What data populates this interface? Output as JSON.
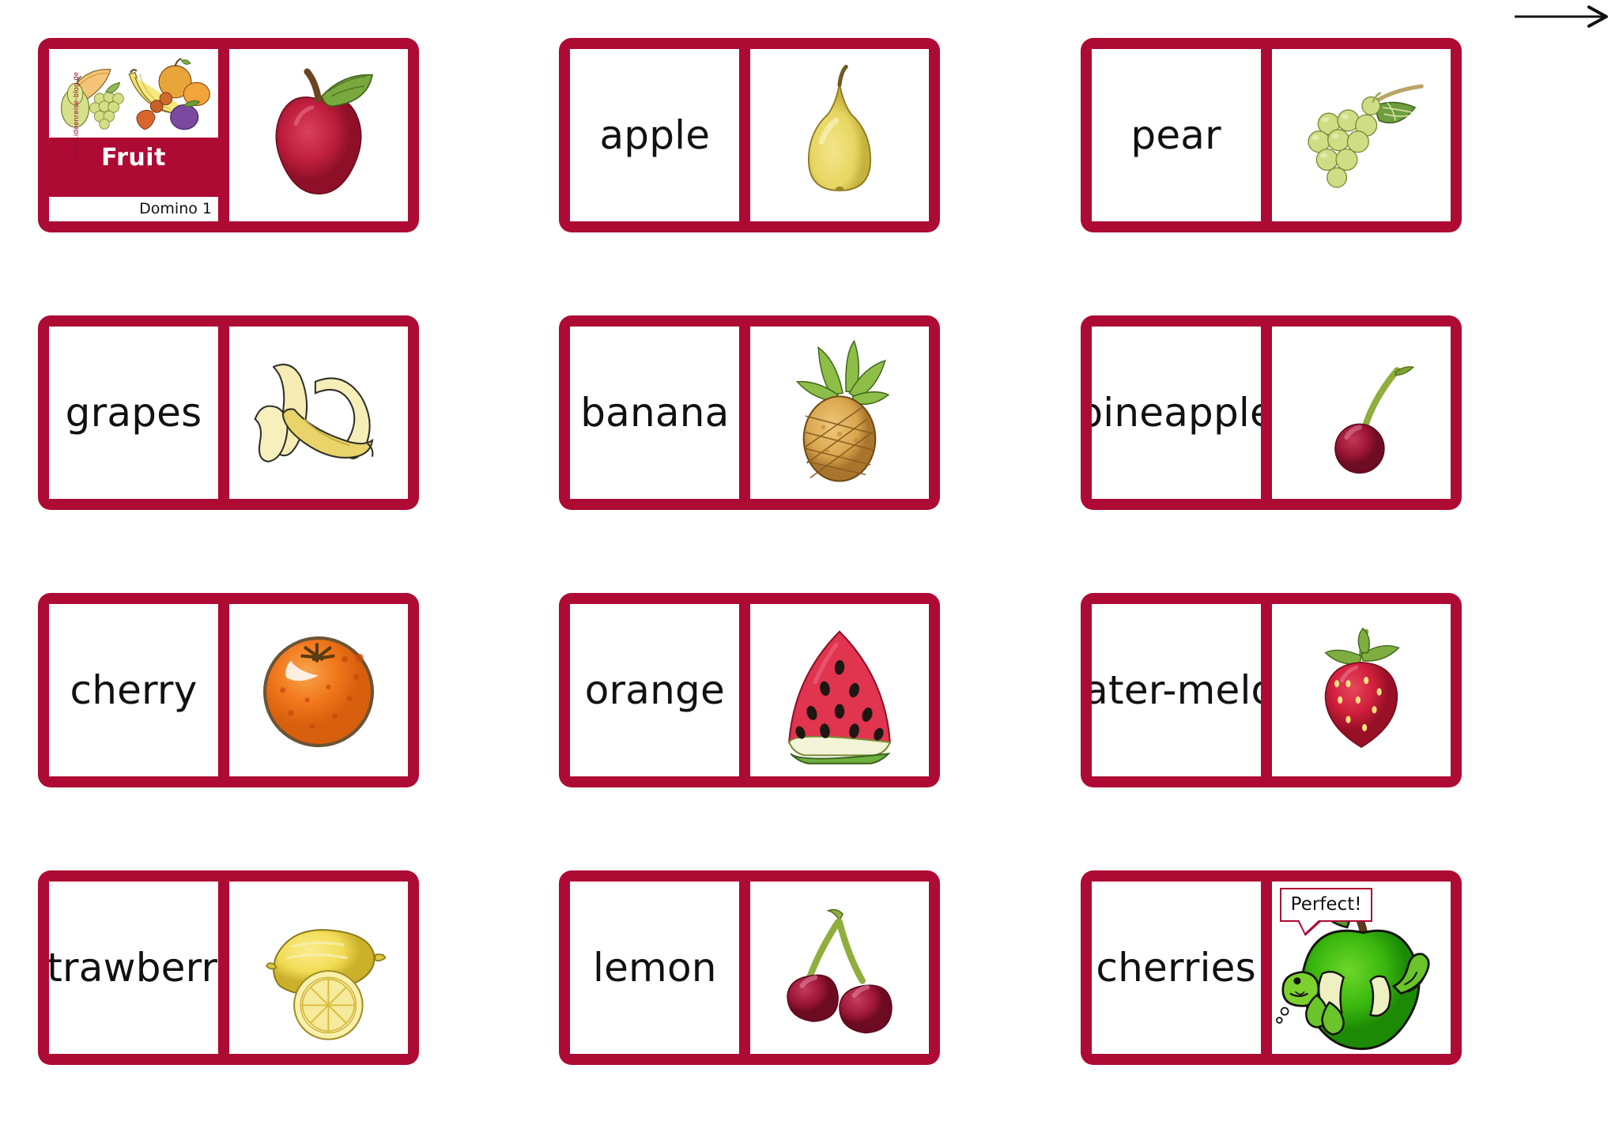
{
  "page": {
    "title": "Fruit",
    "subtitle": "Domino 1",
    "watermark": "© www.ideenreise-blog.de",
    "accent_color": "#ad0a34",
    "background_color": "#ffffff",
    "arrow_label": "next-page-arrow"
  },
  "dominoes": [
    {
      "id": "domino-1",
      "left": {
        "kind": "title",
        "title": "Fruit",
        "subtitle": "Domino 1",
        "picture": "assorted-fruit-basket"
      },
      "right": {
        "kind": "picture",
        "picture": "red-apple",
        "alt": "red apple with green leaf"
      }
    },
    {
      "id": "domino-2",
      "left": {
        "kind": "word",
        "word": "apple"
      },
      "right": {
        "kind": "picture",
        "picture": "pear",
        "alt": "yellow pear"
      }
    },
    {
      "id": "domino-3",
      "left": {
        "kind": "word",
        "word": "pear"
      },
      "right": {
        "kind": "picture",
        "picture": "grapes",
        "alt": "bunch of green grapes with leaf"
      }
    },
    {
      "id": "domino-4",
      "left": {
        "kind": "word",
        "word": "grapes"
      },
      "right": {
        "kind": "picture",
        "picture": "banana",
        "alt": "peeled banana"
      }
    },
    {
      "id": "domino-5",
      "left": {
        "kind": "word",
        "word": "banana"
      },
      "right": {
        "kind": "picture",
        "picture": "pineapple",
        "alt": "pineapple with green crown"
      }
    },
    {
      "id": "domino-6",
      "left": {
        "kind": "word",
        "word": "pineapple"
      },
      "right": {
        "kind": "picture",
        "picture": "cherry",
        "alt": "single red cherry with stem"
      }
    },
    {
      "id": "domino-7",
      "left": {
        "kind": "word",
        "word": "cherry"
      },
      "right": {
        "kind": "picture",
        "picture": "orange",
        "alt": "orange fruit"
      }
    },
    {
      "id": "domino-8",
      "left": {
        "kind": "word",
        "word": "orange"
      },
      "right": {
        "kind": "picture",
        "picture": "watermelon",
        "alt": "slice of watermelon"
      }
    },
    {
      "id": "domino-9",
      "left": {
        "kind": "word",
        "word": "water-\nmelon"
      },
      "right": {
        "kind": "picture",
        "picture": "strawberry",
        "alt": "red strawberry"
      }
    },
    {
      "id": "domino-10",
      "left": {
        "kind": "word",
        "word": "strawberry"
      },
      "right": {
        "kind": "picture",
        "picture": "lemon",
        "alt": "lemon with slice"
      }
    },
    {
      "id": "domino-11",
      "left": {
        "kind": "word",
        "word": "lemon"
      },
      "right": {
        "kind": "picture",
        "picture": "cherries",
        "alt": "pair of cherries"
      }
    },
    {
      "id": "domino-12",
      "left": {
        "kind": "word",
        "word": "cherries"
      },
      "right": {
        "kind": "picture",
        "picture": "green-apple-with-worm",
        "alt": "green apple with worm",
        "bubble": "Perfect!"
      }
    }
  ]
}
